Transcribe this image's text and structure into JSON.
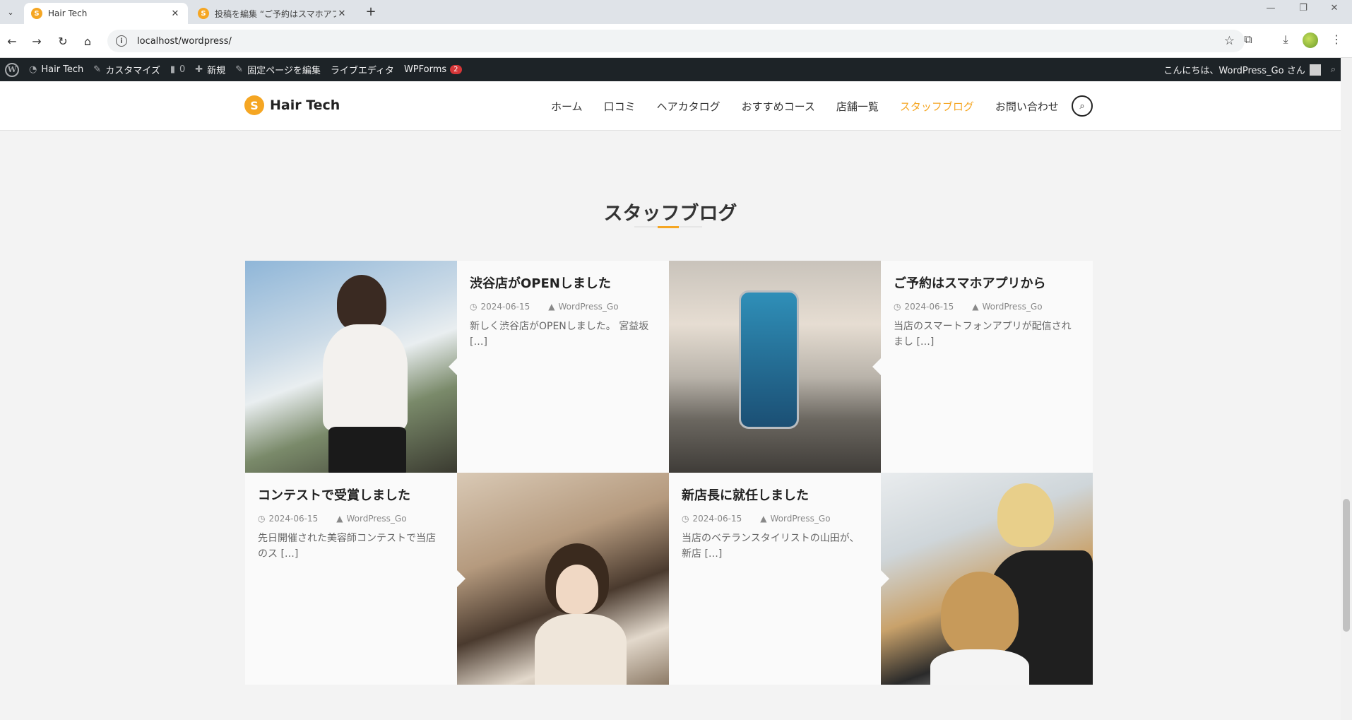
{
  "browser": {
    "tabs": [
      {
        "title": "Hair Tech",
        "active": true,
        "favicon": "S"
      },
      {
        "title": "投稿を編集 “ご予約はスマホアプリから”",
        "active": false,
        "favicon": "S"
      }
    ],
    "url": "localhost/wordpress/"
  },
  "adminbar": {
    "site_name": "Hair Tech",
    "customize": "カスタマイズ",
    "comments_count": "0",
    "new": "新規",
    "edit_page": "固定ページを編集",
    "live_editor": "ライブエディタ",
    "wpforms": "WPForms",
    "wpforms_badge": "2",
    "greeting": "こんにちは、WordPress_Go さん"
  },
  "site": {
    "logo_text": "Hair Tech",
    "logo_mark": "S",
    "menu": [
      "ホーム",
      "口コミ",
      "ヘアカタログ",
      "おすすめコース",
      "店舗一覧",
      "スタッフブログ",
      "お問い合わせ"
    ],
    "current_menu": "スタッフブログ",
    "accent_color": "#f5a623"
  },
  "section": {
    "title": "スタッフブログ"
  },
  "posts": [
    {
      "title": "渋谷店がOPENしました",
      "date": "2024-06-15",
      "author": "WordPress_Go",
      "excerpt": "新しく渋谷店がOPENしました。 宮益坂 […]",
      "image": "woman-businesswear"
    },
    {
      "title": "ご予約はスマホアプリから",
      "date": "2024-06-15",
      "author": "WordPress_Go",
      "excerpt": "当店のスマートフォンアプリが配信されまし […]",
      "image": "smartphone-on-wood"
    },
    {
      "title": "コンテストで受賞しました",
      "date": "2024-06-15",
      "author": "WordPress_Go",
      "excerpt": "先日開催された美容師コンテストで当店のス […]",
      "image": "stylists-group"
    },
    {
      "title": "新店長に就任しました",
      "date": "2024-06-15",
      "author": "WordPress_Go",
      "excerpt": "当店のベテランスタイリストの山田が、新店 […]",
      "image": "stylist-with-client"
    }
  ]
}
